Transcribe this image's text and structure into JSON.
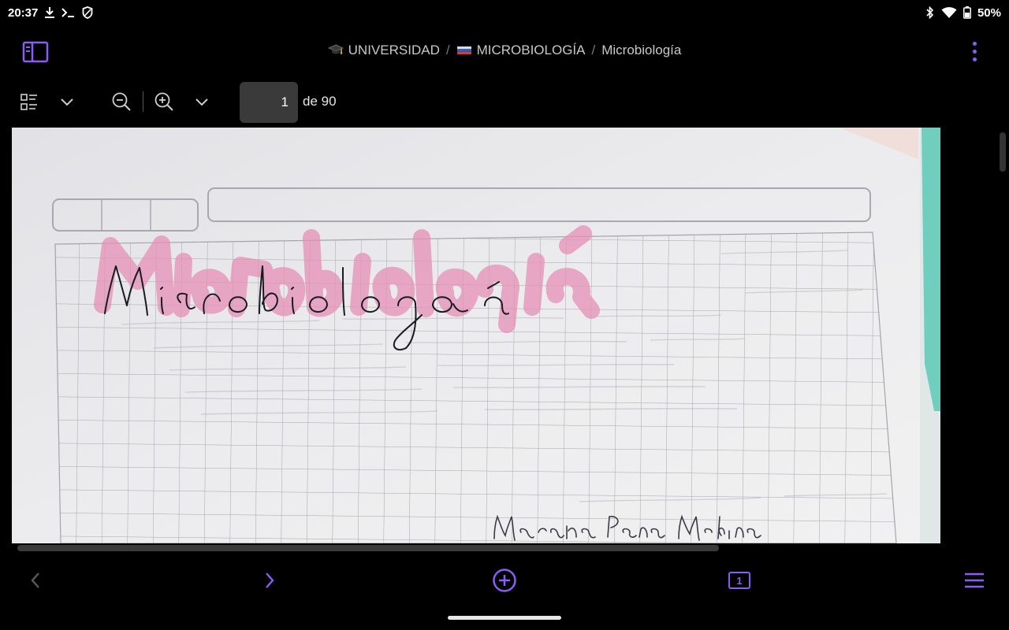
{
  "colors": {
    "accent": "#8b5cf6",
    "background": "#000000",
    "paper": "#eaeaec",
    "ink_pink": "#e48fb5",
    "tab_teal": "#5cc9b5"
  },
  "status_bar": {
    "time": "20:37",
    "battery": "50%",
    "left_icons": [
      "download-icon",
      "terminal-icon",
      "shield-icon"
    ],
    "right_icons": [
      "bluetooth-icon",
      "wifi-icon",
      "battery-icon"
    ]
  },
  "header": {
    "breadcrumb": [
      {
        "icon": "graduation-cap-icon",
        "label": "UNIVERSIDAD"
      },
      {
        "icon": "flag-icon",
        "label": "MICROBIOLOGÍA"
      },
      {
        "label": "Microbiología"
      }
    ],
    "separator": "/"
  },
  "toolbar": {
    "current_page": "1",
    "total_pages": "de 90"
  },
  "document": {
    "handwritten_title": "Microbiología",
    "handwritten_author": "Mariana Peña Medina"
  }
}
